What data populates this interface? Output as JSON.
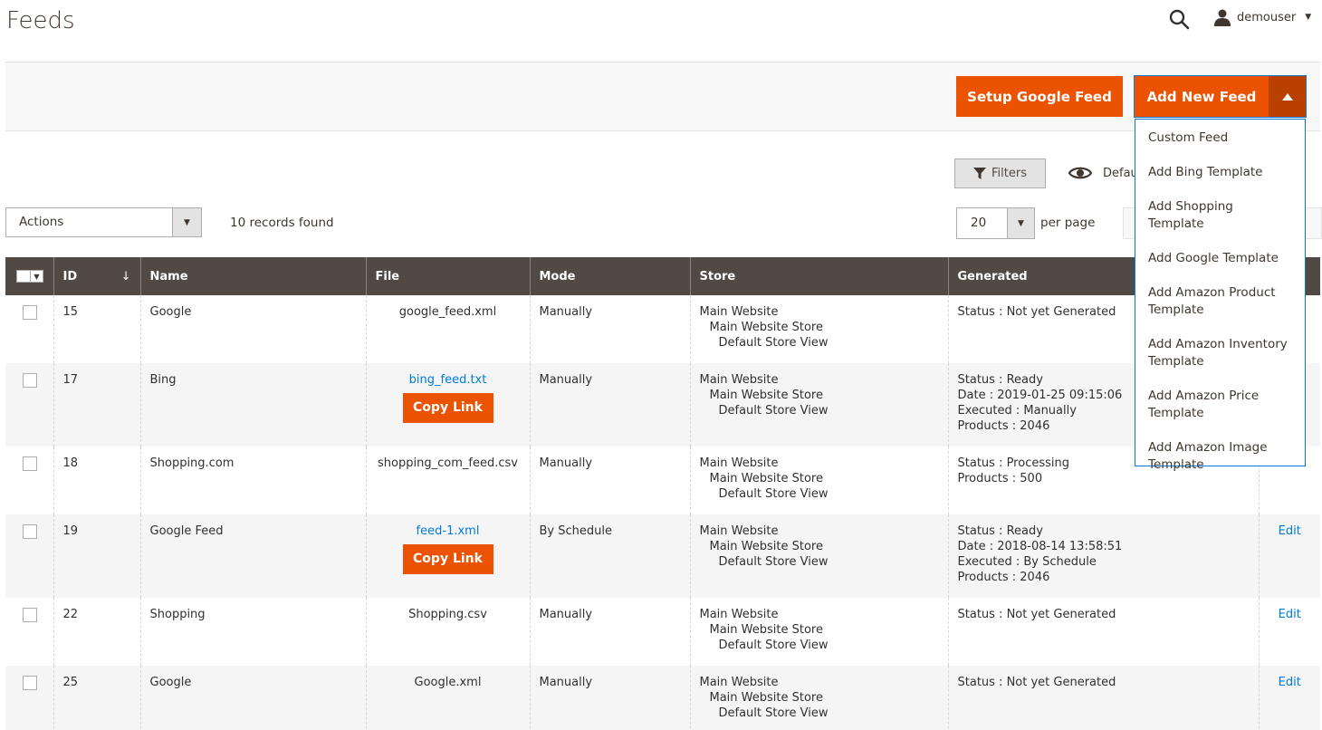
{
  "header": {
    "title": "Feeds",
    "user": "demouser"
  },
  "actions": {
    "setup_google": "Setup Google Feed",
    "add_new": "Add New Feed",
    "dropdown_items": [
      "Custom Feed",
      "Add Bing Template",
      "Add Shopping Template",
      "Add Google Template",
      "Add Amazon Product Template",
      "Add Amazon Inventory Template",
      "Add Amazon Price Template",
      "Add Amazon Image Template"
    ]
  },
  "toolbar": {
    "filters": "Filters",
    "view_label": "Defau",
    "mass_actions": "Actions",
    "records_found": "10 records found",
    "per_page_value": "20",
    "per_page_label": "per page"
  },
  "grid": {
    "columns": [
      "ID",
      "Name",
      "File",
      "Mode",
      "Store",
      "Generated",
      ""
    ],
    "store": [
      "Main Website",
      "Main Website Store",
      "Default Store View"
    ],
    "copy_label": "Copy Link",
    "edit_label": "Edit",
    "rows": [
      {
        "id": "15",
        "name": "Google",
        "file": "google_feed.xml",
        "file_link": false,
        "mode": "Manually",
        "generated": [
          "Status : Not yet Generated"
        ],
        "edit": ""
      },
      {
        "id": "17",
        "name": "Bing",
        "file": "bing_feed.txt",
        "file_link": true,
        "mode": "Manually",
        "generated": [
          "Status : Ready",
          "Date : 2019-01-25 09:15:06",
          "Executed : Manually",
          "Products : 2046"
        ],
        "edit": ""
      },
      {
        "id": "18",
        "name": "Shopping.com",
        "file": "shopping_com_feed.csv",
        "file_link": false,
        "mode": "Manually",
        "generated": [
          "Status : Processing",
          "Products : 500"
        ],
        "edit": "Edit"
      },
      {
        "id": "19",
        "name": "Google Feed",
        "file": "feed-1.xml",
        "file_link": true,
        "mode": "By Schedule",
        "generated": [
          "Status : Ready",
          "Date : 2018-08-14 13:58:51",
          "Executed : By Schedule",
          "Products : 2046"
        ],
        "edit": "Edit"
      },
      {
        "id": "22",
        "name": "Shopping",
        "file": "Shopping.csv",
        "file_link": false,
        "mode": "Manually",
        "generated": [
          "Status : Not yet Generated"
        ],
        "edit": "Edit"
      },
      {
        "id": "25",
        "name": "Google",
        "file": "Google.xml",
        "file_link": false,
        "mode": "Manually",
        "generated": [
          "Status : Not yet Generated"
        ],
        "edit": "Edit"
      }
    ]
  },
  "colors": {
    "accent": "#eb5202",
    "accent_dark": "#ba4000",
    "header_bg": "#514943",
    "link": "#007bdb"
  }
}
